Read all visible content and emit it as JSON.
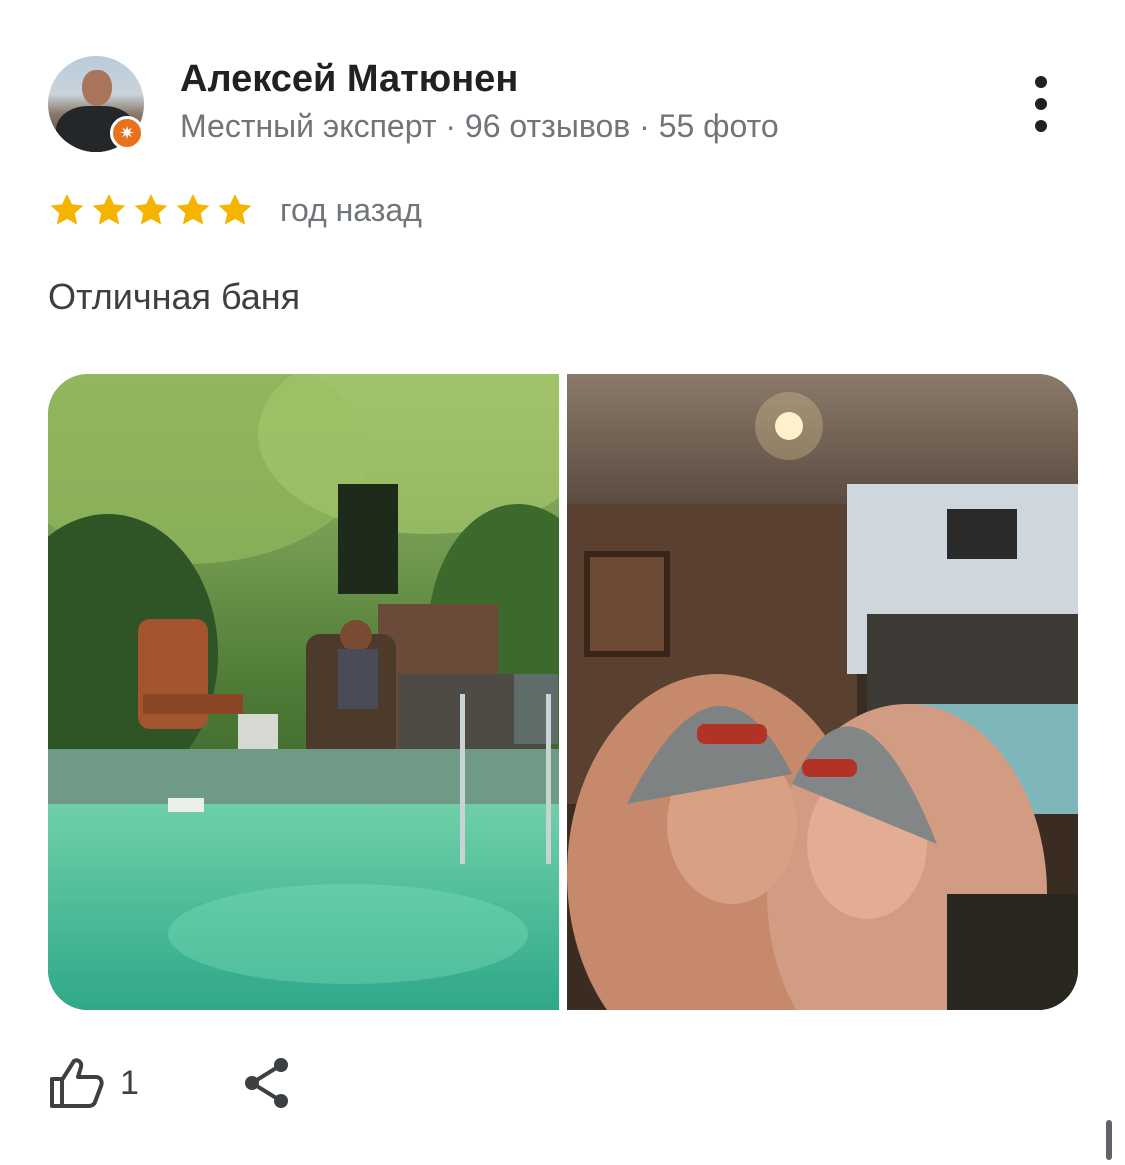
{
  "review": {
    "author": {
      "name": "Алексей Матюнен",
      "meta": "Местный эксперт · 96 отзывов · 55 фото",
      "badge_icon": "local-guide-star-icon",
      "badge_color": "#E8711C"
    },
    "rating": {
      "stars": 5,
      "max": 5,
      "star_color": "#F4B400",
      "time_ago": "год назад"
    },
    "text": "Отличная баня",
    "photos": [
      {
        "subject": "pool-garden-photo"
      },
      {
        "subject": "sauna-selfie-photo"
      }
    ],
    "actions": {
      "like_icon": "thumbs-up-icon",
      "like_count": "1",
      "share_icon": "share-icon"
    }
  }
}
